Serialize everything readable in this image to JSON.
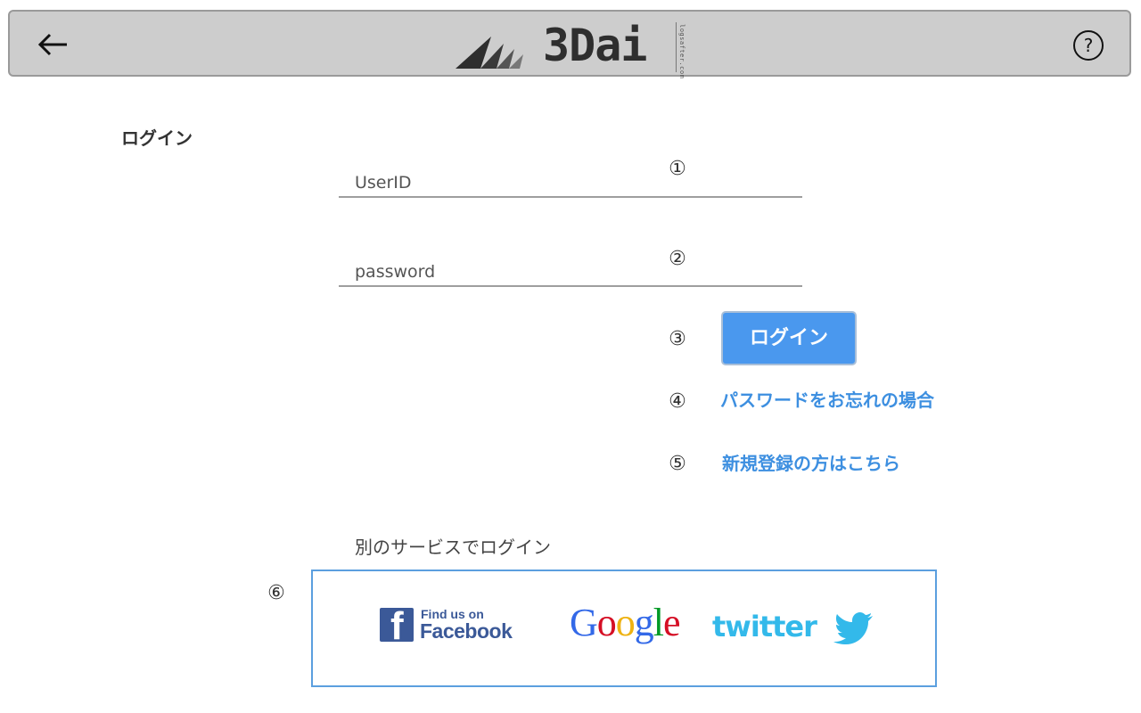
{
  "header": {
    "back_icon": "arrow-left-icon",
    "help_icon": "question-circle-icon",
    "logo_text": "3Dai",
    "logo_subtext": "logsafter.com"
  },
  "page": {
    "title": "ログイン"
  },
  "form": {
    "userid_placeholder": "UserID",
    "password_placeholder": "password",
    "login_button": "ログイン",
    "forgot_password_link": "パスワードをお忘れの場合",
    "register_link": "新規登録の方はこちら"
  },
  "markers": {
    "m1": "①",
    "m2": "②",
    "m3": "③",
    "m4": "④",
    "m5": "⑤",
    "m6": "⑥"
  },
  "social": {
    "label": "別のサービスでログイン",
    "facebook_small": "Find us on",
    "facebook_big": "Facebook",
    "facebook_letter": "f",
    "google": [
      "G",
      "o",
      "o",
      "g",
      "l",
      "e"
    ],
    "twitter": "twitter"
  },
  "colors": {
    "header_bg": "#cdcdcd",
    "button_bg": "#4a98ee",
    "link": "#3d8fe0",
    "facebook": "#3b5998",
    "twitter": "#33b9ea",
    "social_border": "#5b9fdf"
  }
}
